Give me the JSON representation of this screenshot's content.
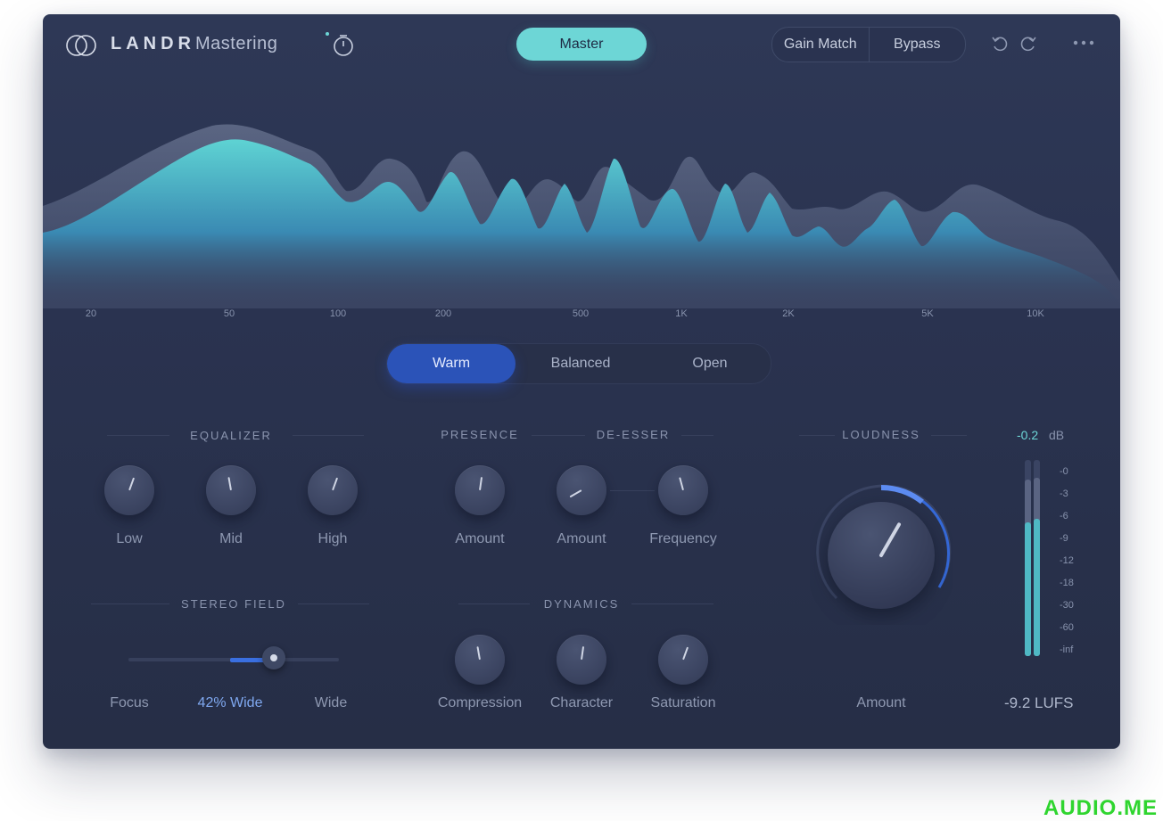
{
  "header": {
    "brand": "LANDR",
    "product": "Mastering",
    "master_label": "Master",
    "gain_match_label": "Gain Match",
    "bypass_label": "Bypass"
  },
  "spectrum": {
    "freq_labels": [
      "20",
      "50",
      "100",
      "200",
      "500",
      "1K",
      "2K",
      "5K",
      "10K"
    ]
  },
  "mode": {
    "options": [
      "Warm",
      "Balanced",
      "Open"
    ],
    "selected": "Warm"
  },
  "equalizer": {
    "title": "EQUALIZER",
    "knobs": [
      {
        "label": "Low",
        "angle": 20
      },
      {
        "label": "Mid",
        "angle": -10
      },
      {
        "label": "High",
        "angle": 20
      }
    ]
  },
  "presence": {
    "title": "PRESENCE",
    "knob": {
      "label": "Amount",
      "angle": 8
    }
  },
  "deesser": {
    "title": "DE-ESSER",
    "knobs": [
      {
        "label": "Amount",
        "angle": -120
      },
      {
        "label": "Frequency",
        "angle": -15
      }
    ]
  },
  "stereo": {
    "title": "STEREO FIELD",
    "left_label": "Focus",
    "value_label": "42% Wide",
    "right_label": "Wide",
    "value": 0.42
  },
  "dynamics": {
    "title": "DYNAMICS",
    "knobs": [
      {
        "label": "Compression",
        "angle": -10
      },
      {
        "label": "Character",
        "angle": 8
      },
      {
        "label": "Saturation",
        "angle": 20
      }
    ]
  },
  "loudness": {
    "title": "LOUDNESS",
    "amount_label": "Amount",
    "angle": 30,
    "db_value": "-0.2",
    "db_unit": "dB",
    "meter_scale": [
      "-0",
      "-3",
      "-6",
      "-9",
      "-12",
      "-18",
      "-30",
      "-60",
      "-inf"
    ],
    "lufs": "-9.2 LUFS"
  },
  "watermark": "AUDIO.ME",
  "colors": {
    "accent_teal": "#6dd6d6",
    "accent_blue": "#2b53b8",
    "panel": "#2a3350"
  }
}
